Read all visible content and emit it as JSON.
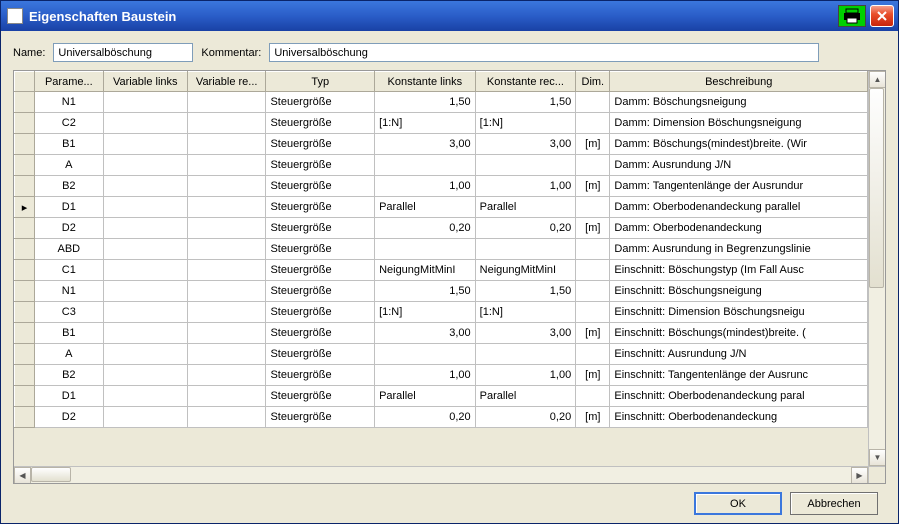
{
  "window": {
    "title": "Eigenschaften Baustein"
  },
  "form": {
    "name_label": "Name:",
    "name_value": "Universalböschung",
    "comment_label": "Kommentar:",
    "comment_value": "Universalböschung"
  },
  "columns": {
    "param": "Parame...",
    "varl": "Variable links",
    "varr": "Variable re...",
    "typ": "Typ",
    "konstl": "Konstante links",
    "konstr": "Konstante rec...",
    "dim": "Dim.",
    "besch": "Beschreibung"
  },
  "rows": [
    {
      "marker": "",
      "param": "N1",
      "varl": "",
      "varr": "",
      "typ": "Steuergröße",
      "konstl": "1,50",
      "konstr": "1,50",
      "dim": "",
      "besch": "Damm: Böschungsneigung",
      "num": true
    },
    {
      "marker": "",
      "param": "C2",
      "varl": "",
      "varr": "",
      "typ": "Steuergröße",
      "konstl": "[1:N]",
      "konstr": "[1:N]",
      "dim": "",
      "besch": "Damm: Dimension Böschungsneigung",
      "num": false
    },
    {
      "marker": "",
      "param": "B1",
      "varl": "",
      "varr": "",
      "typ": "Steuergröße",
      "konstl": "3,00",
      "konstr": "3,00",
      "dim": "[m]",
      "besch": "Damm: Böschungs(mindest)breite. (Wir",
      "num": true
    },
    {
      "marker": "",
      "param": "A",
      "varl": "",
      "varr": "",
      "typ": "Steuergröße",
      "konstl": "",
      "konstr": "",
      "dim": "",
      "besch": "Damm: Ausrundung J/N",
      "num": false
    },
    {
      "marker": "",
      "param": "B2",
      "varl": "",
      "varr": "",
      "typ": "Steuergröße",
      "konstl": "1,00",
      "konstr": "1,00",
      "dim": "[m]",
      "besch": "Damm: Tangentenlänge der Ausrundur",
      "num": true
    },
    {
      "marker": "▸",
      "param": "D1",
      "varl": "",
      "varr": "",
      "typ": "Steuergröße",
      "konstl": "Parallel",
      "konstr": "Parallel",
      "dim": "",
      "besch": "Damm: Oberbodenandeckung parallel",
      "num": false
    },
    {
      "marker": "",
      "param": "D2",
      "varl": "",
      "varr": "",
      "typ": "Steuergröße",
      "konstl": "0,20",
      "konstr": "0,20",
      "dim": "[m]",
      "besch": "Damm: Oberbodenandeckung",
      "num": true
    },
    {
      "marker": "",
      "param": "ABD",
      "varl": "",
      "varr": "",
      "typ": "Steuergröße",
      "konstl": "",
      "konstr": "",
      "dim": "",
      "besch": "Damm: Ausrundung in Begrenzungslinie",
      "num": false
    },
    {
      "marker": "",
      "param": "C1",
      "varl": "",
      "varr": "",
      "typ": "Steuergröße",
      "konstl": "NeigungMitMinI",
      "konstr": "NeigungMitMinI",
      "dim": "",
      "besch": "Einschnitt: Böschungstyp (Im Fall Ausc",
      "num": false
    },
    {
      "marker": "",
      "param": "N1",
      "varl": "",
      "varr": "",
      "typ": "Steuergröße",
      "konstl": "1,50",
      "konstr": "1,50",
      "dim": "",
      "besch": "Einschnitt: Böschungsneigung",
      "num": true
    },
    {
      "marker": "",
      "param": "C3",
      "varl": "",
      "varr": "",
      "typ": "Steuergröße",
      "konstl": "[1:N]",
      "konstr": "[1:N]",
      "dim": "",
      "besch": "Einschnitt: Dimension Böschungsneigu",
      "num": false
    },
    {
      "marker": "",
      "param": "B1",
      "varl": "",
      "varr": "",
      "typ": "Steuergröße",
      "konstl": "3,00",
      "konstr": "3,00",
      "dim": "[m]",
      "besch": "Einschnitt: Böschungs(mindest)breite. (",
      "num": true
    },
    {
      "marker": "",
      "param": "A",
      "varl": "",
      "varr": "",
      "typ": "Steuergröße",
      "konstl": "",
      "konstr": "",
      "dim": "",
      "besch": "Einschnitt: Ausrundung J/N",
      "num": false
    },
    {
      "marker": "",
      "param": "B2",
      "varl": "",
      "varr": "",
      "typ": "Steuergröße",
      "konstl": "1,00",
      "konstr": "1,00",
      "dim": "[m]",
      "besch": "Einschnitt: Tangentenlänge der Ausrunc",
      "num": true
    },
    {
      "marker": "",
      "param": "D1",
      "varl": "",
      "varr": "",
      "typ": "Steuergröße",
      "konstl": "Parallel",
      "konstr": "Parallel",
      "dim": "",
      "besch": "Einschnitt: Oberbodenandeckung paral",
      "num": false
    },
    {
      "marker": "",
      "param": "D2",
      "varl": "",
      "varr": "",
      "typ": "Steuergröße",
      "konstl": "0,20",
      "konstr": "0,20",
      "dim": "[m]",
      "besch": "Einschnitt: Oberbodenandeckung",
      "num": true
    }
  ],
  "buttons": {
    "ok": "OK",
    "cancel": "Abbrechen"
  }
}
